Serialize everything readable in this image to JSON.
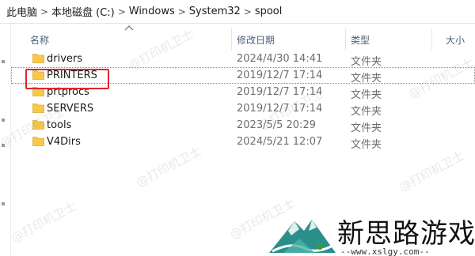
{
  "breadcrumb": {
    "items": [
      "此电脑",
      "本地磁盘 (C:)",
      "Windows",
      "System32",
      "spool"
    ],
    "separator": ">"
  },
  "columns": {
    "name": "名称",
    "date": "修改日期",
    "type": "类型",
    "size": "大小"
  },
  "files": [
    {
      "name": "drivers",
      "date": "2024/4/30 14:41",
      "type": "文件夹"
    },
    {
      "name": "PRINTERS",
      "date": "2019/12/7 17:14",
      "type": "文件夹",
      "highlighted": true
    },
    {
      "name": "prtprocs",
      "date": "2019/12/7 17:14",
      "type": "文件夹"
    },
    {
      "name": "SERVERS",
      "date": "2019/12/7 17:14",
      "type": "文件夹"
    },
    {
      "name": "tools",
      "date": "2023/5/5 20:29",
      "type": "文件夹"
    },
    {
      "name": "V4Dirs",
      "date": "2024/5/21 12:07",
      "type": "文件夹"
    }
  ],
  "watermark": "@打印机卫士",
  "logo": {
    "title": "新思路游戏",
    "url": "--www.xslgy.com--"
  },
  "colors": {
    "highlight": "#e0252e",
    "folder": "#f7c948",
    "header_text": "#4c607a"
  }
}
